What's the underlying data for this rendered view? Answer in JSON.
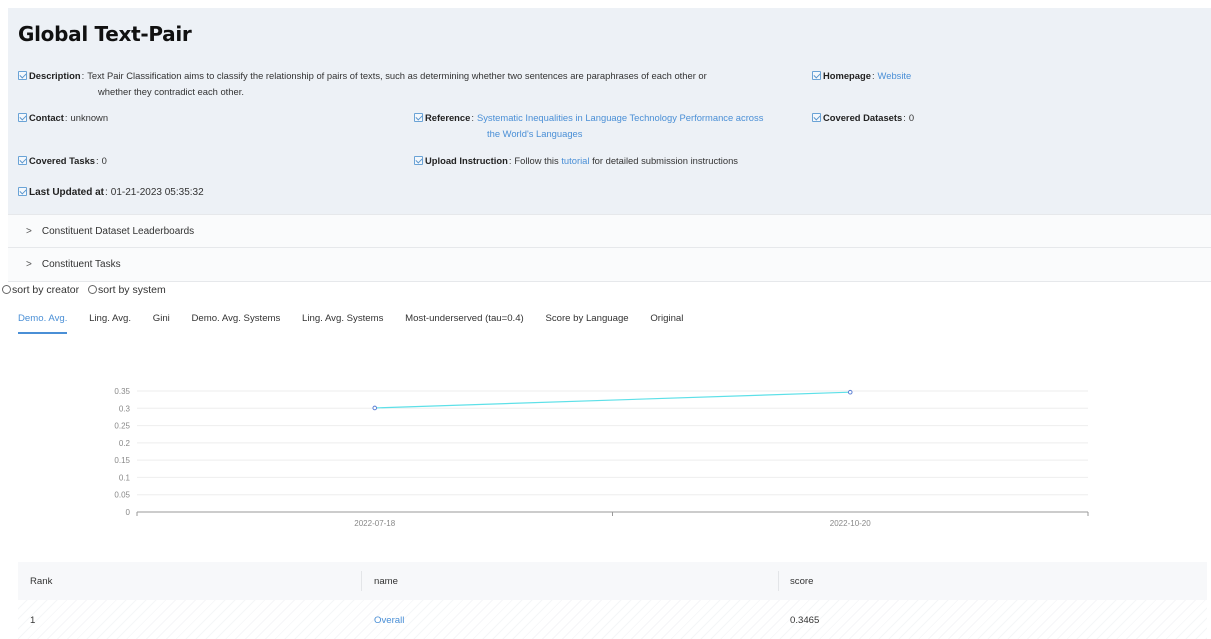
{
  "title": "Global Text-Pair",
  "info": {
    "description": {
      "label": "Description",
      "line1": "Text Pair Classification aims to classify the relationship of pairs of texts, such as determining whether two sentences are paraphrases of each other or",
      "line2": "whether they contradict each other."
    },
    "homepage": {
      "label": "Homepage",
      "value": "Website"
    },
    "contact": {
      "label": "Contact",
      "value": "unknown"
    },
    "reference": {
      "label": "Reference",
      "line1": "Systematic Inequalities in Language Technology Performance across",
      "line2": "the World's Languages"
    },
    "covered_datasets": {
      "label": "Covered Datasets",
      "value": "0"
    },
    "covered_tasks": {
      "label": "Covered Tasks",
      "value": "0"
    },
    "upload_instruction": {
      "label": "Upload Instruction",
      "prefix": "Follow this",
      "link": "tutorial",
      "suffix": "for detailed submission instructions"
    },
    "last_updated": {
      "label": "Last Updated at",
      "value": "01-21-2023 05:35:32"
    }
  },
  "collapses": [
    {
      "label": "Constituent Dataset Leaderboards"
    },
    {
      "label": "Constituent Tasks"
    }
  ],
  "sort_options": [
    "sort by creator",
    "sort by system"
  ],
  "tabs": [
    {
      "label": "Demo. Avg.",
      "active": true
    },
    {
      "label": "Ling. Avg.",
      "active": false
    },
    {
      "label": "Gini",
      "active": false
    },
    {
      "label": "Demo. Avg. Systems",
      "active": false
    },
    {
      "label": "Ling. Avg. Systems",
      "active": false
    },
    {
      "label": "Most-underserved (tau=0.4)",
      "active": false
    },
    {
      "label": "Score by Language",
      "active": false
    },
    {
      "label": "Original",
      "active": false
    }
  ],
  "chart_data": {
    "type": "line",
    "x": [
      "2022-07-18",
      "2022-10-20"
    ],
    "series": [
      {
        "values": [
          0.301,
          0.3465
        ]
      }
    ],
    "ylim": [
      0,
      0.35
    ],
    "yticks": [
      "0",
      "0.05",
      "0.1",
      "0.15",
      "0.2",
      "0.25",
      "0.3",
      "0.35"
    ],
    "grid": true,
    "line_color": "#5ee0e8",
    "point_color": "#5b7fd4"
  },
  "table": {
    "headers": [
      "Rank",
      "name",
      "score"
    ],
    "rows": [
      {
        "rank": "1",
        "name": "Overall",
        "score": "0.3465"
      }
    ]
  },
  "colors": {
    "accent": "#4a8fd6",
    "panel_bg": "#edf1f6"
  }
}
